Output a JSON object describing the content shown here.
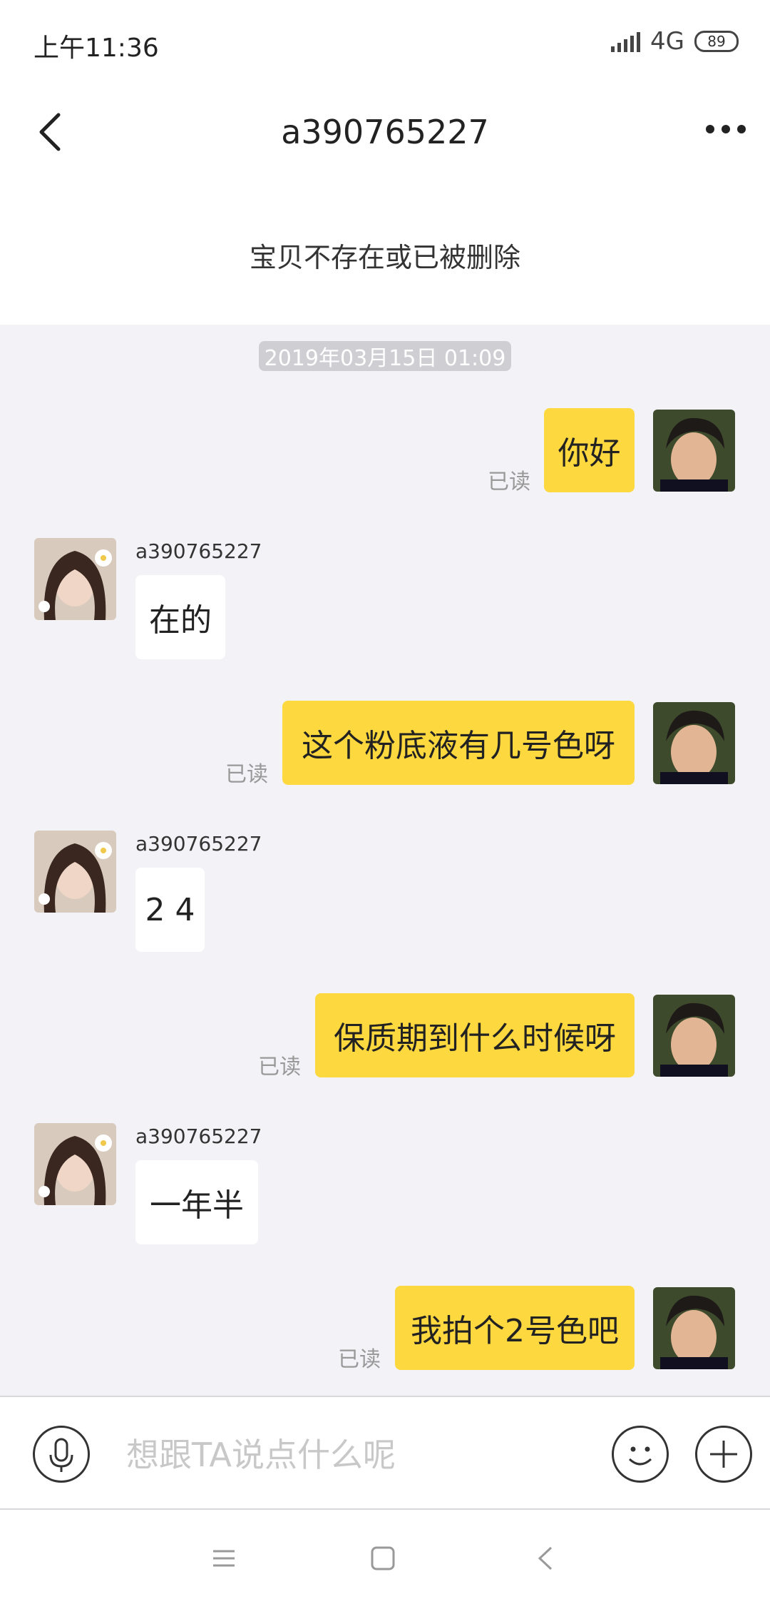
{
  "status": {
    "time": "上午11:36",
    "network": "4G",
    "battery": "89"
  },
  "header": {
    "title": "a390765227"
  },
  "notice": {
    "text": "宝贝不存在或已被删除"
  },
  "chat": {
    "timestamp": "2019年03月15日 01:09",
    "messages": [
      {
        "side": "mine",
        "text": "你好",
        "status": "已读"
      },
      {
        "side": "theirs",
        "sender": "a390765227",
        "text": "在的"
      },
      {
        "side": "mine",
        "text": "这个粉底液有几号色呀",
        "status": "已读"
      },
      {
        "side": "theirs",
        "sender": "a390765227",
        "text": "2 4"
      },
      {
        "side": "mine",
        "text": "保质期到什么时候呀",
        "status": "已读"
      },
      {
        "side": "theirs",
        "sender": "a390765227",
        "text": "一年半"
      },
      {
        "side": "mine",
        "text": "我拍个2号色吧",
        "status": "已读"
      }
    ]
  },
  "composer": {
    "placeholder": "想跟TA说点什么呢"
  },
  "colors": {
    "mine_bubble": "#fdd83f",
    "theirs_bubble": "#ffffff",
    "chat_bg": "#f3f3f7"
  }
}
